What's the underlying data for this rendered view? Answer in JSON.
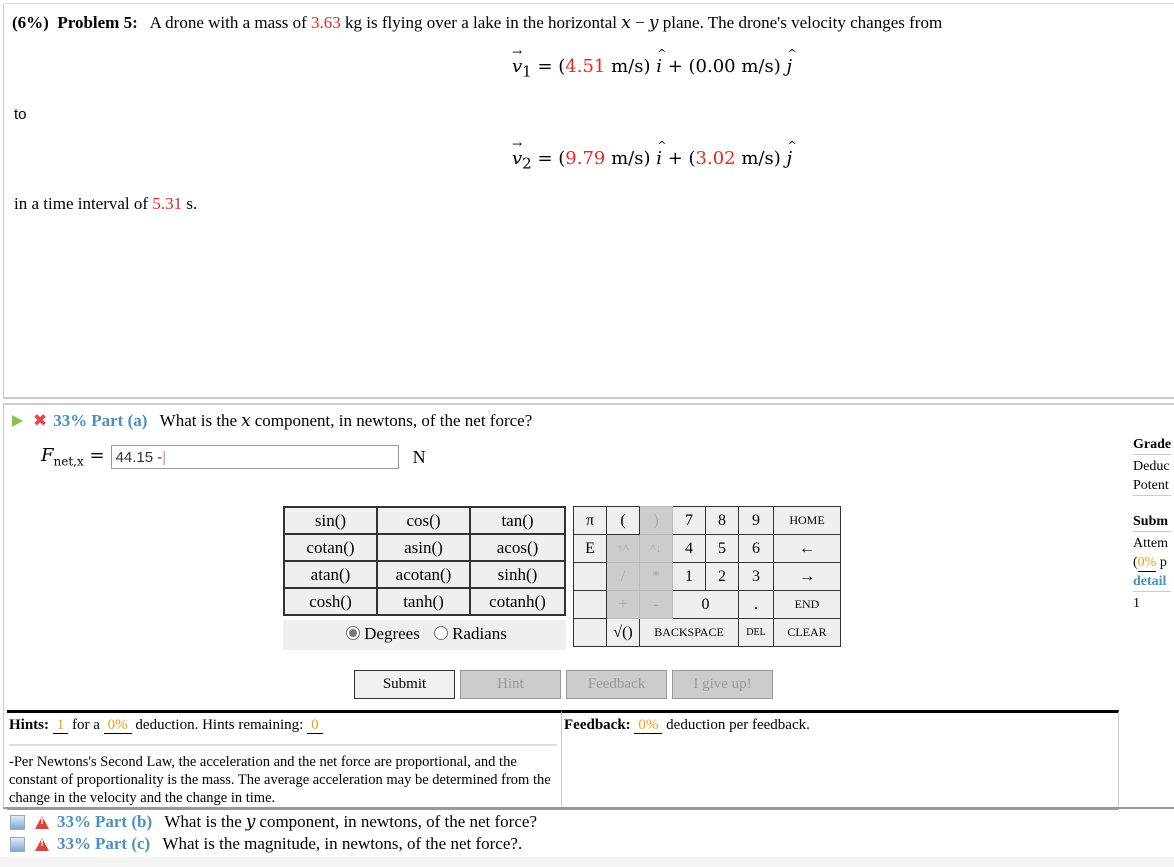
{
  "problem": {
    "weight": "(6%)",
    "label": "Problem 5:",
    "text_before_mass": "A drone with a mass of",
    "mass": "3.63",
    "text_after_mass": "kg is flying over a lake in the horizontal",
    "plane_x": "x",
    "plane_dash": " − ",
    "plane_y": "y",
    "text_end": "plane. The drone's velocity changes from",
    "v1": {
      "symbol": "v",
      "sub": "1",
      "x_value": "4.51",
      "y_value": "0.00",
      "unit": "m/s"
    },
    "to_text": "to",
    "v2": {
      "symbol": "v",
      "sub": "2",
      "x_value": "9.79",
      "y_value": "3.02",
      "unit": "m/s"
    },
    "time_prefix": "in a time interval of",
    "time_value": "5.31",
    "time_unit": "s."
  },
  "part_a": {
    "percent": "33%",
    "label": "Part (a)",
    "question_pre": "What is the",
    "question_var": "x",
    "question_post": "component, in newtons, of the net force?",
    "answer_symbol": "F",
    "answer_sub": "net,x",
    "answer_equals": "=",
    "answer_value": "44.15 -",
    "unit": "N"
  },
  "sidebar": {
    "grade_title": "Grade",
    "deduction": "Deduc",
    "potential": "Potent",
    "submissions_title": "Subm",
    "attempts": "Attem",
    "percent_prefix": "(",
    "percent": "0%",
    "percent_suffix": " p",
    "details_link": "detail",
    "count": "1"
  },
  "calculator": {
    "functions": [
      [
        "sin()",
        "cos()",
        "tan()"
      ],
      [
        "cotan()",
        "asin()",
        "acos()"
      ],
      [
        "atan()",
        "acotan()",
        "sinh()"
      ],
      [
        "cosh()",
        "tanh()",
        "cotanh()"
      ]
    ],
    "angle_modes": [
      {
        "label": "Degrees",
        "selected": true
      },
      {
        "label": "Radians",
        "selected": false
      }
    ],
    "keys": {
      "pi": "π",
      "e": "E",
      "lparen": "(",
      "rparen": ")",
      "up": "↑^",
      "down": "^↓",
      "divide": "/",
      "multiply": "*",
      "plus": "+",
      "minus": "-",
      "sqrt": "√()",
      "n7": "7",
      "n8": "8",
      "n9": "9",
      "n4": "4",
      "n5": "5",
      "n6": "6",
      "n1": "1",
      "n2": "2",
      "n3": "3",
      "n0": "0",
      "dot": ".",
      "home": "HOME",
      "left": "←",
      "right": "→",
      "end": "END",
      "backspace": "BACKSPACE",
      "del": "DEL",
      "clear": "CLEAR"
    }
  },
  "buttons": {
    "submit": "Submit",
    "hint": "Hint",
    "feedback": "Feedback",
    "give_up": "I give up!"
  },
  "hints": {
    "title": "Hints:",
    "count": "1",
    "for_a": "for a",
    "deduction": "0%",
    "deduction_text": "deduction. Hints remaining:",
    "remaining": "0",
    "hint_text": "-Per Newtons's Second Law, the acceleration and the net force are proportional, and the constant of proportionality is the mass. The average acceleration may be determined from the change in the velocity and the change in time."
  },
  "feedback": {
    "title": "Feedback:",
    "deduction": "0%",
    "text": "deduction per feedback."
  },
  "part_b": {
    "percent": "33%",
    "label": "Part (b)",
    "question_pre": "What is the",
    "question_var": "y",
    "question_post": "component, in newtons, of the net force?"
  },
  "part_c": {
    "percent": "33%",
    "label": "Part (c)",
    "question": "What is the magnitude, in newtons, of the net force?."
  },
  "colors": {
    "given_value": "#e8281e",
    "part_label": "#4a90c0",
    "deduction": "#f39c1a"
  }
}
